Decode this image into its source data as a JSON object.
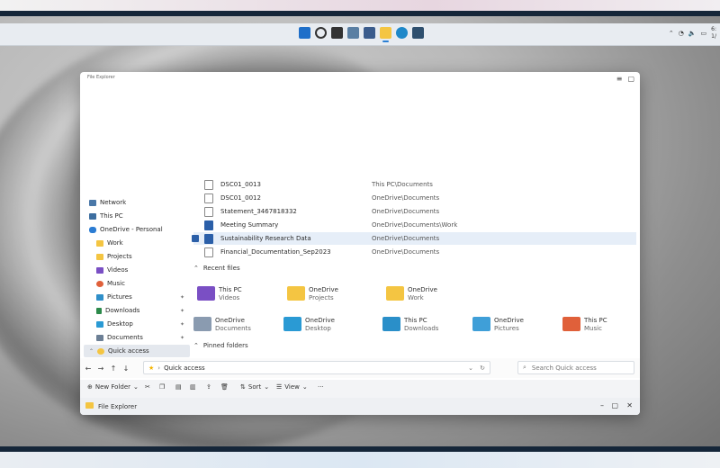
{
  "taskbar": {
    "icons": [
      "windows-icon",
      "search-icon",
      "task-view-icon",
      "widgets-icon",
      "store-icon",
      "file-explorer-icon",
      "edge-icon",
      "terminal-icon"
    ],
    "clock_time": "6:",
    "clock_date": "1/"
  },
  "window": {
    "top_title": "File Explorer",
    "title": "File Explorer",
    "sidebar": [
      {
        "label": "Network"
      },
      {
        "label": "This PC"
      },
      {
        "label": "OneDrive - Personal"
      },
      {
        "label": "Work"
      },
      {
        "label": "Projects"
      },
      {
        "label": "Videos"
      },
      {
        "label": "Music"
      },
      {
        "label": "Pictures"
      },
      {
        "label": "Downloads"
      },
      {
        "label": "Desktop"
      },
      {
        "label": "Documents"
      },
      {
        "label": "Quick access"
      }
    ],
    "recent_files": [
      {
        "name": "DSC01_0013",
        "location": "This PC\\Documents"
      },
      {
        "name": "DSC01_0012",
        "location": "OneDrive\\Documents"
      },
      {
        "name": "Statement_3467818332",
        "location": "OneDrive\\Documents"
      },
      {
        "name": "Meeting Summary",
        "location": "OneDrive\\Documents\\Work"
      },
      {
        "name": "Sustainability Research Data",
        "location": "OneDrive\\Documents"
      },
      {
        "name": "Financial_Documentation_Sep2023",
        "location": "OneDrive\\Documents"
      }
    ],
    "recent_files_header": "Recent files",
    "quick_access": [
      {
        "name": "Videos",
        "location": "This PC"
      },
      {
        "name": "Projects",
        "location": "OneDrive"
      },
      {
        "name": "Work",
        "location": "OneDrive"
      },
      {
        "name": "Documents",
        "location": "OneDrive"
      },
      {
        "name": "Desktop",
        "location": "OneDrive"
      },
      {
        "name": "Downloads",
        "location": "This PC"
      },
      {
        "name": "Pictures",
        "location": "OneDrive"
      },
      {
        "name": "Music",
        "location": "This PC"
      }
    ],
    "quick_access_header": "Pinned folders",
    "address": "Quick access",
    "search_placeholder": "Search Quick access",
    "cmd": {
      "new": "New Folder",
      "sort": "Sort",
      "view": "View",
      "more": "···"
    }
  },
  "colors": {
    "accent": "#2b5fa8",
    "folder_yellow": "#f4c542",
    "onedrive_blue": "#2b7cd3"
  }
}
